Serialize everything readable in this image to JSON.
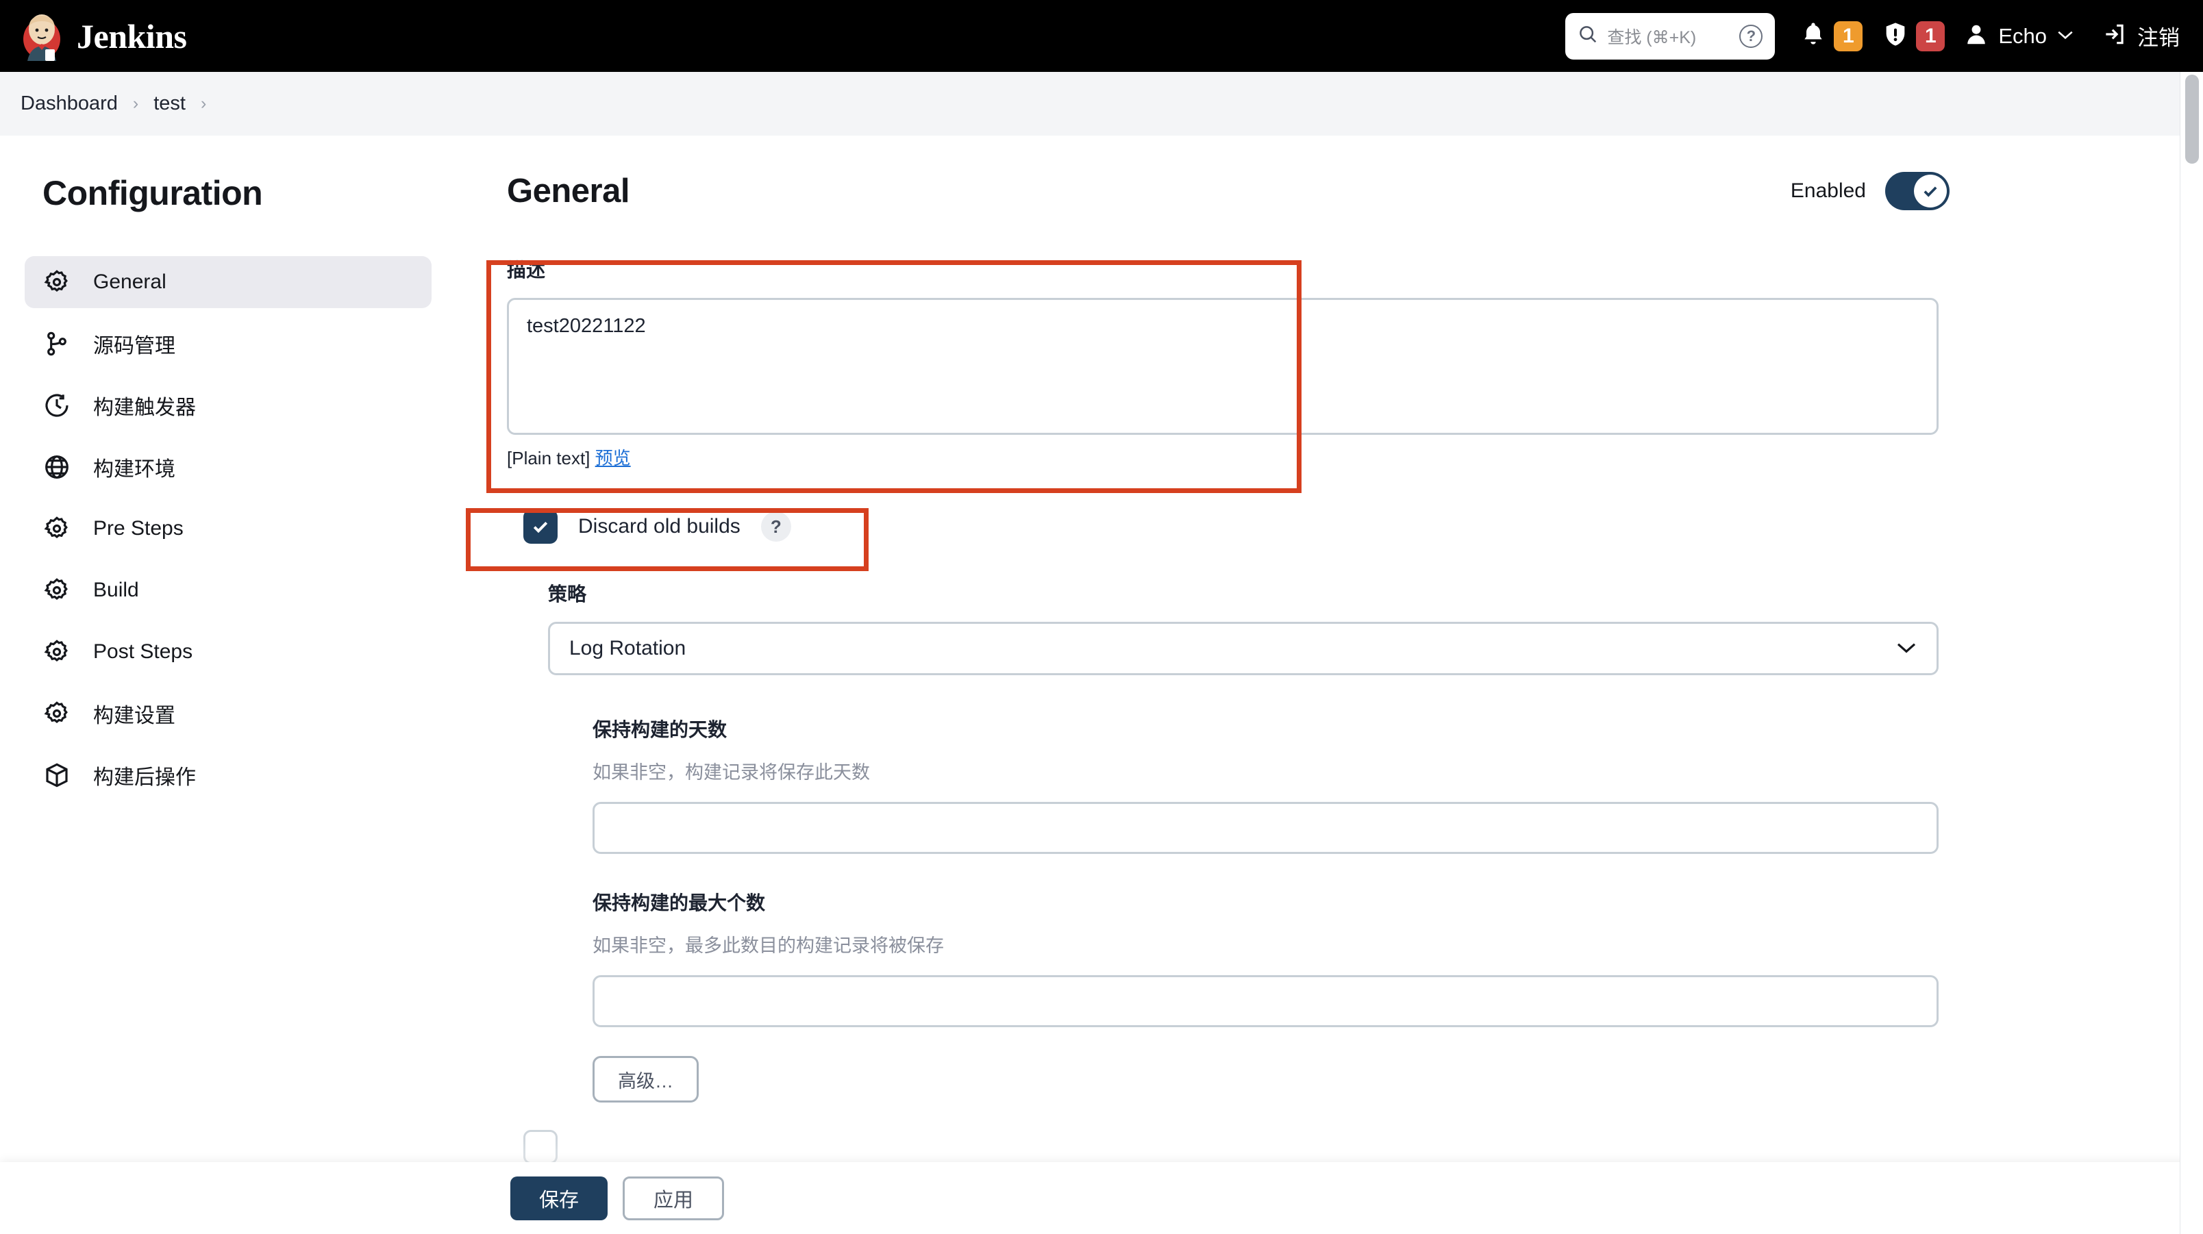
{
  "header": {
    "brand": "Jenkins",
    "logo_icon": "jenkins-butler-logo",
    "search": {
      "placeholder": "查找 (⌘+K)",
      "icon": "search-icon",
      "help_icon": "help-circle-icon"
    },
    "notifications": {
      "icon": "bell-icon",
      "count": "1",
      "color": "#ef9b2d"
    },
    "security": {
      "icon": "shield-exclamation-icon",
      "count": "1",
      "color": "#cc4545"
    },
    "user": {
      "icon": "person-icon",
      "name": "Echo",
      "chevron_icon": "chevron-down-icon"
    },
    "logout": {
      "icon": "logout-arrow-icon",
      "label": "注销"
    }
  },
  "breadcrumb": {
    "items": [
      "Dashboard",
      "test"
    ],
    "separator": "›"
  },
  "sidebar": {
    "title": "Configuration",
    "items": [
      {
        "label": "General",
        "icon": "gear-icon",
        "active": true
      },
      {
        "label": "源码管理",
        "icon": "git-branch-icon",
        "active": false
      },
      {
        "label": "构建触发器",
        "icon": "clock-icon",
        "active": false
      },
      {
        "label": "构建环境",
        "icon": "globe-icon",
        "active": false
      },
      {
        "label": "Pre Steps",
        "icon": "gear-icon",
        "active": false
      },
      {
        "label": "Build",
        "icon": "gear-icon",
        "active": false
      },
      {
        "label": "Post Steps",
        "icon": "gear-icon",
        "active": false
      },
      {
        "label": "构建设置",
        "icon": "gear-icon",
        "active": false
      },
      {
        "label": "构建后操作",
        "icon": "package-icon",
        "active": false
      }
    ]
  },
  "main": {
    "title": "General",
    "enabled_toggle": {
      "label": "Enabled",
      "state": "on",
      "icon": "check-icon",
      "color": "#1f3f5e"
    },
    "description": {
      "label": "描述",
      "value": "test20221122",
      "markup_note": "[Plain text]",
      "preview_link": "预览"
    },
    "discard_old_builds": {
      "label": "Discard old builds",
      "checked": true,
      "help_icon": "question-mark-icon",
      "help_label": "?"
    },
    "strategy": {
      "label": "策略",
      "selected": "Log Rotation",
      "chevron_icon": "chevron-down-icon"
    },
    "days_to_keep": {
      "label": "保持构建的天数",
      "hint": "如果非空，构建记录将保存此天数",
      "value": ""
    },
    "max_builds_to_keep": {
      "label": "保持构建的最大个数",
      "hint": "如果非空，最多此数目的构建记录将被保存",
      "value": ""
    },
    "advanced_button": "高级…"
  },
  "footer": {
    "save_label": "保存",
    "apply_label": "应用"
  },
  "annotations": {
    "color": "#d6401f",
    "boxes": [
      "description-section",
      "discard-old-builds-row"
    ]
  }
}
